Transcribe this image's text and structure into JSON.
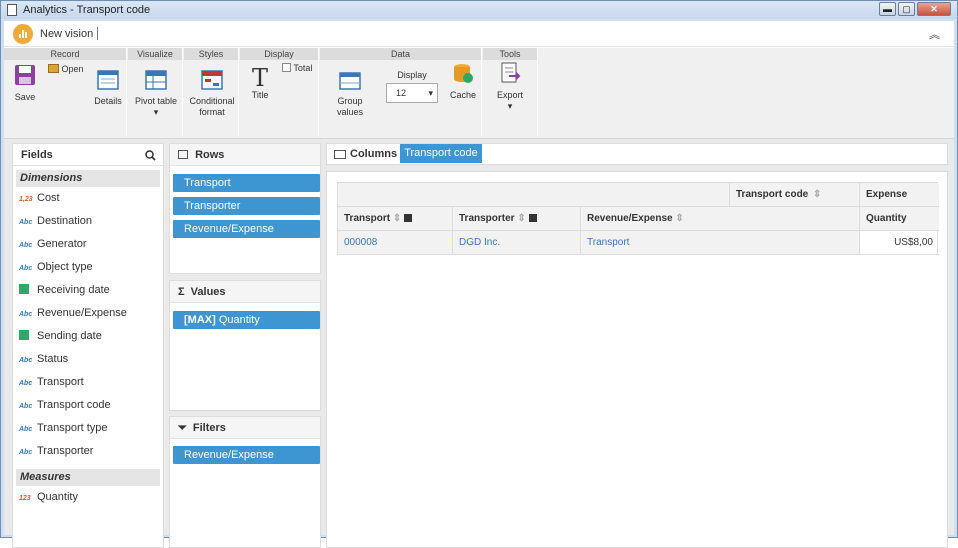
{
  "window": {
    "title": "Analytics - Transport code",
    "min": "▬",
    "max": "▢",
    "close": "✕"
  },
  "header": {
    "title": "New vision",
    "collapse": "︽"
  },
  "ribbon": {
    "groups": {
      "record": "Record",
      "visualize": "Visualize",
      "styles": "Styles",
      "display": "Display",
      "data": "Data",
      "tools": "Tools"
    },
    "save": "Save",
    "open": "Open",
    "details": "Details",
    "pivot_table": "Pivot table",
    "conditional_format_1": "Conditional",
    "conditional_format_2": "format",
    "title": "Title",
    "total": "Total",
    "group_values": "Group values",
    "display_label": "Display",
    "display_value": "12",
    "cache": "Cache",
    "export": "Export",
    "dropdown": "▾"
  },
  "fields": {
    "title": "Fields",
    "dimensions_label": "Dimensions",
    "dimensions": [
      {
        "type": "1,23",
        "label": "Cost"
      },
      {
        "type": "Abc",
        "label": "Destination"
      },
      {
        "type": "Abc",
        "label": "Generator"
      },
      {
        "type": "Abc",
        "label": "Object type"
      },
      {
        "type": "date",
        "label": "Receiving date"
      },
      {
        "type": "Abc",
        "label": "Revenue/Expense"
      },
      {
        "type": "date",
        "label": "Sending date"
      },
      {
        "type": "Abc",
        "label": "Status"
      },
      {
        "type": "Abc",
        "label": "Transport"
      },
      {
        "type": "Abc",
        "label": "Transport code"
      },
      {
        "type": "Abc",
        "label": "Transport type"
      },
      {
        "type": "Abc",
        "label": "Transporter"
      }
    ],
    "measures_label": "Measures",
    "measures": [
      {
        "type": "123",
        "label": "Quantity"
      }
    ]
  },
  "rows": {
    "title": "Rows",
    "items": [
      "Transport",
      "Transporter",
      "Revenue/Expense"
    ]
  },
  "values": {
    "title": "Values",
    "prefix": "[MAX]",
    "item": "Quantity"
  },
  "filters": {
    "title": "Filters",
    "items": [
      "Revenue/Expense"
    ]
  },
  "columns": {
    "title": "Columns",
    "items": [
      "Transport code"
    ]
  },
  "grid": {
    "col_header_field": "Transport code",
    "col_value": "Expense",
    "row_headers": [
      "Transport",
      "Transporter",
      "Revenue/Expense"
    ],
    "measure_header": "Quantity",
    "rows": [
      {
        "transport": "000008",
        "transporter": "DGD Inc.",
        "revenue_expense": "Transport",
        "quantity": "US$8,00"
      }
    ]
  },
  "colors": {
    "accent": "#3d96d1",
    "logo": "#f1a93a"
  }
}
